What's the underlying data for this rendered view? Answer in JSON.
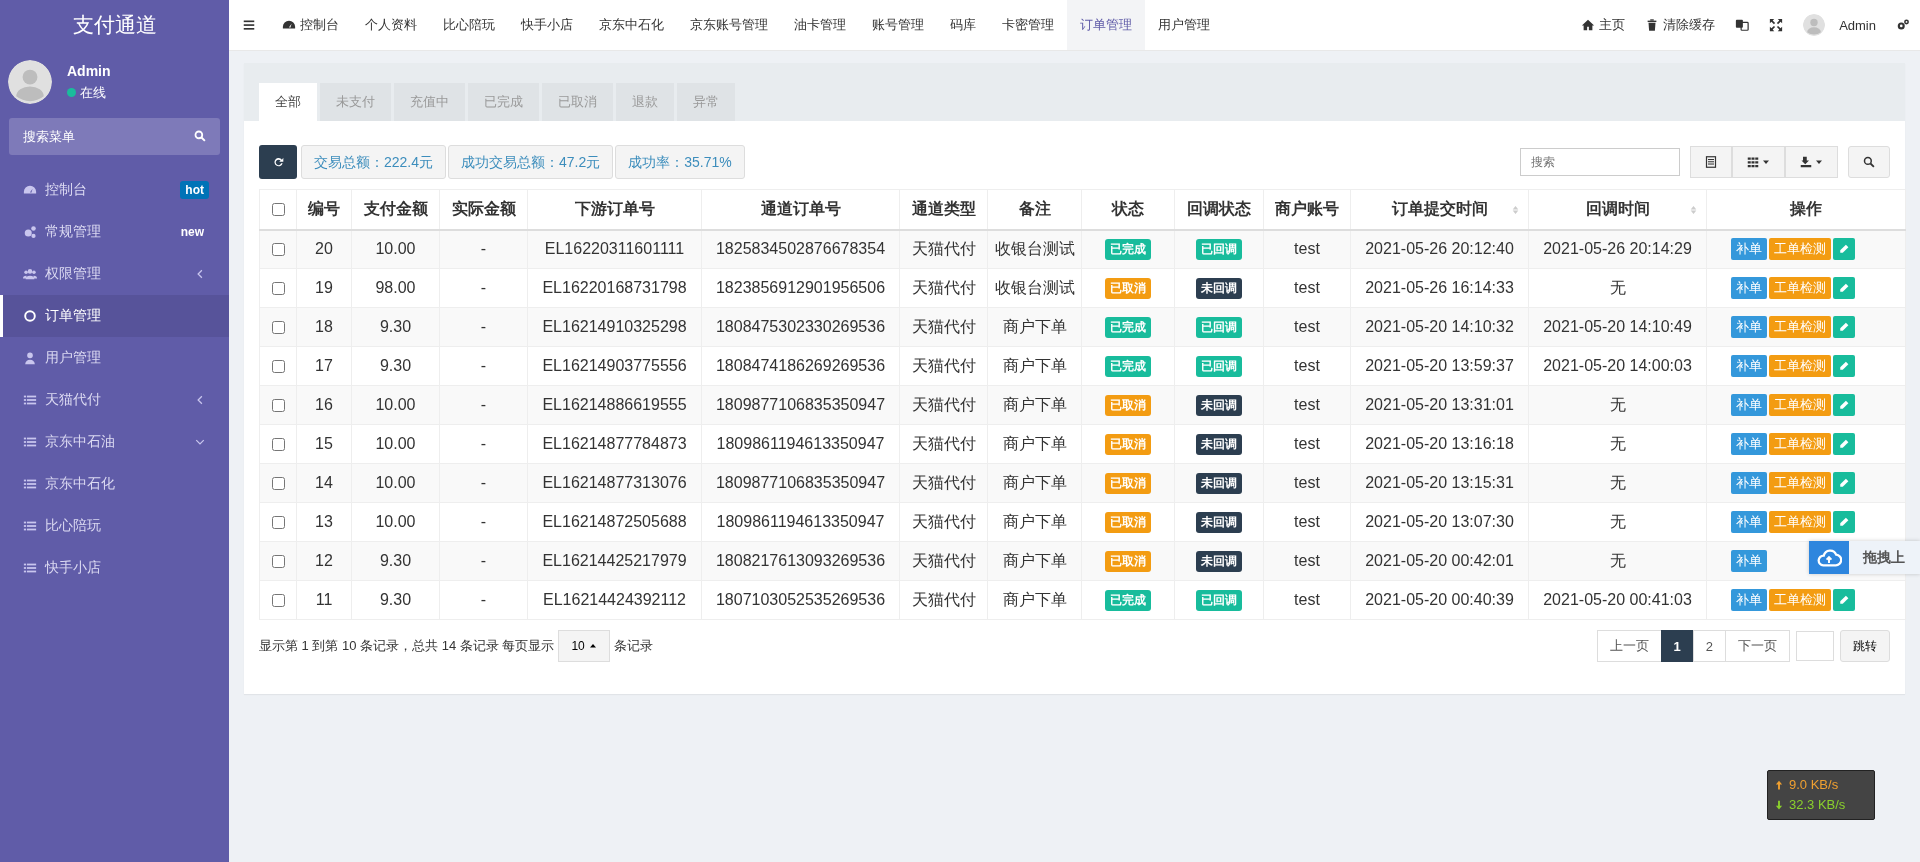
{
  "sidebar": {
    "title": "支付通道",
    "user": {
      "name": "Admin",
      "status": "在线"
    },
    "search": {
      "placeholder": "搜索菜单"
    },
    "items": [
      {
        "label": "控制台",
        "kind": "dashboard",
        "selected": false,
        "badge": {
          "text": "hot",
          "kind": "filled"
        }
      },
      {
        "label": "常规管理",
        "kind": "cogs",
        "selected": false,
        "badge": {
          "text": "new",
          "kind": "plain"
        }
      },
      {
        "label": "权限管理",
        "kind": "users",
        "selected": false,
        "expanded": false
      },
      {
        "label": "订单管理",
        "kind": "circle",
        "selected": true
      },
      {
        "label": "用户管理",
        "kind": "user",
        "selected": false
      },
      {
        "label": "天猫代付",
        "kind": "list",
        "selected": false,
        "expanded": false
      },
      {
        "label": "京东中石油",
        "kind": "list",
        "selected": false,
        "expanded": true
      },
      {
        "label": "京东中石化",
        "kind": "list",
        "selected": false
      },
      {
        "label": "比心陪玩",
        "kind": "list",
        "selected": false
      },
      {
        "label": "快手小店",
        "kind": "list",
        "selected": false
      }
    ]
  },
  "topnav": {
    "items": [
      {
        "label": "控制台",
        "kind": "dashboard",
        "selected": false
      },
      {
        "label": "个人资料",
        "selected": false
      },
      {
        "label": "比心陪玩",
        "selected": false
      },
      {
        "label": "快手小店",
        "selected": false
      },
      {
        "label": "京东中石化",
        "selected": false
      },
      {
        "label": "京东账号管理",
        "selected": false
      },
      {
        "label": "油卡管理",
        "selected": false
      },
      {
        "label": "账号管理",
        "selected": false
      },
      {
        "label": "码库",
        "selected": false
      },
      {
        "label": "卡密管理",
        "selected": false
      },
      {
        "label": "订单管理",
        "selected": true
      },
      {
        "label": "用户管理",
        "selected": false
      }
    ],
    "right": [
      {
        "label": "主页",
        "kind": "home"
      },
      {
        "label": "清除缓存",
        "kind": "trash"
      },
      {
        "kind": "translate"
      },
      {
        "kind": "fullscreen"
      },
      {
        "label": "Admin",
        "kind": "avatar"
      },
      {
        "kind": "settings"
      }
    ]
  },
  "tabs": [
    {
      "label": "全部",
      "selected": true
    },
    {
      "label": "未支付",
      "selected": false
    },
    {
      "label": "充值中",
      "selected": false
    },
    {
      "label": "已完成",
      "selected": false
    },
    {
      "label": "已取消",
      "selected": false
    },
    {
      "label": "退款",
      "selected": false
    },
    {
      "label": "异常",
      "selected": false
    }
  ],
  "stats": [
    "交易总额：222.4元",
    "成功交易总额：47.2元",
    "成功率：35.71%"
  ],
  "search": {
    "placeholder": "搜索"
  },
  "table": {
    "select_all": {
      "checked": false
    },
    "columns": [
      {
        "label": "编号"
      },
      {
        "label": "支付金额"
      },
      {
        "label": "实际金额"
      },
      {
        "label": "下游订单号"
      },
      {
        "label": "通道订单号"
      },
      {
        "label": "通道类型"
      },
      {
        "label": "备注"
      },
      {
        "label": "状态"
      },
      {
        "label": "回调状态"
      },
      {
        "label": "商户账号"
      },
      {
        "label": "订单提交时间",
        "sortable": true
      },
      {
        "label": "回调时间",
        "sortable": true
      },
      {
        "label": "操作"
      }
    ],
    "rows": [
      {
        "checked": false,
        "cells": [
          "20",
          "10.00",
          "-",
          "EL16220311601111",
          "1825834502876678354",
          "天猫代付",
          "收银台测试"
        ],
        "status": {
          "text": "已完成",
          "color": "#18bc9c"
        },
        "callback": {
          "text": "已回调",
          "color": "#18bc9c"
        },
        "account": "test",
        "submitted": "2021-05-26 20:12:40",
        "callback_time": "2021-05-26 20:14:29",
        "actions": [
          "补单",
          "工单检测"
        ],
        "edit": true
      },
      {
        "checked": false,
        "cells": [
          "19",
          "98.00",
          "-",
          "EL16220168731798",
          "1823856912901956506",
          "天猫代付",
          "收银台测试"
        ],
        "status": {
          "text": "已取消",
          "color": "#f39c12"
        },
        "callback": {
          "text": "未回调",
          "color": "#2c3e50"
        },
        "account": "test",
        "submitted": "2021-05-26 16:14:33",
        "callback_time": "无",
        "actions": [
          "补单",
          "工单检测"
        ],
        "edit": true
      },
      {
        "checked": false,
        "cells": [
          "18",
          "9.30",
          "-",
          "EL16214910325298",
          "1808475302330269536",
          "天猫代付",
          "商户下单"
        ],
        "status": {
          "text": "已完成",
          "color": "#18bc9c"
        },
        "callback": {
          "text": "已回调",
          "color": "#18bc9c"
        },
        "account": "test",
        "submitted": "2021-05-20 14:10:32",
        "callback_time": "2021-05-20 14:10:49",
        "actions": [
          "补单",
          "工单检测"
        ],
        "edit": true
      },
      {
        "checked": false,
        "cells": [
          "17",
          "9.30",
          "-",
          "EL16214903775556",
          "1808474186269269536",
          "天猫代付",
          "商户下单"
        ],
        "status": {
          "text": "已完成",
          "color": "#18bc9c"
        },
        "callback": {
          "text": "已回调",
          "color": "#18bc9c"
        },
        "account": "test",
        "submitted": "2021-05-20 13:59:37",
        "callback_time": "2021-05-20 14:00:03",
        "actions": [
          "补单",
          "工单检测"
        ],
        "edit": true
      },
      {
        "checked": false,
        "cells": [
          "16",
          "10.00",
          "-",
          "EL16214886619555",
          "1809877106835350947",
          "天猫代付",
          "商户下单"
        ],
        "status": {
          "text": "已取消",
          "color": "#f39c12"
        },
        "callback": {
          "text": "未回调",
          "color": "#2c3e50"
        },
        "account": "test",
        "submitted": "2021-05-20 13:31:01",
        "callback_time": "无",
        "actions": [
          "补单",
          "工单检测"
        ],
        "edit": true
      },
      {
        "checked": false,
        "cells": [
          "15",
          "10.00",
          "-",
          "EL16214877784873",
          "1809861194613350947",
          "天猫代付",
          "商户下单"
        ],
        "status": {
          "text": "已取消",
          "color": "#f39c12"
        },
        "callback": {
          "text": "未回调",
          "color": "#2c3e50"
        },
        "account": "test",
        "submitted": "2021-05-20 13:16:18",
        "callback_time": "无",
        "actions": [
          "补单",
          "工单检测"
        ],
        "edit": true
      },
      {
        "checked": false,
        "cells": [
          "14",
          "10.00",
          "-",
          "EL16214877313076",
          "1809877106835350947",
          "天猫代付",
          "商户下单"
        ],
        "status": {
          "text": "已取消",
          "color": "#f39c12"
        },
        "callback": {
          "text": "未回调",
          "color": "#2c3e50"
        },
        "account": "test",
        "submitted": "2021-05-20 13:15:31",
        "callback_time": "无",
        "actions": [
          "补单",
          "工单检测"
        ],
        "edit": true
      },
      {
        "checked": false,
        "cells": [
          "13",
          "10.00",
          "-",
          "EL16214872505688",
          "1809861194613350947",
          "天猫代付",
          "商户下单"
        ],
        "status": {
          "text": "已取消",
          "color": "#f39c12"
        },
        "callback": {
          "text": "未回调",
          "color": "#2c3e50"
        },
        "account": "test",
        "submitted": "2021-05-20 13:07:30",
        "callback_time": "无",
        "actions": [
          "补单",
          "工单检测"
        ],
        "edit": true
      },
      {
        "checked": false,
        "cells": [
          "12",
          "9.30",
          "-",
          "EL16214425217979",
          "1808217613093269536",
          "天猫代付",
          "商户下单"
        ],
        "status": {
          "text": "已取消",
          "color": "#f39c12"
        },
        "callback": {
          "text": "未回调",
          "color": "#2c3e50"
        },
        "account": "test",
        "submitted": "2021-05-20 00:42:01",
        "callback_time": "无",
        "actions": [
          "补单"
        ],
        "edit": false
      },
      {
        "checked": false,
        "cells": [
          "11",
          "9.30",
          "-",
          "EL16214424392112",
          "1807103052535269536",
          "天猫代付",
          "商户下单"
        ],
        "status": {
          "text": "已完成",
          "color": "#18bc9c"
        },
        "callback": {
          "text": "已回调",
          "color": "#18bc9c"
        },
        "account": "test",
        "submitted": "2021-05-20 00:40:39",
        "callback_time": "2021-05-20 00:41:03",
        "actions": [
          "补单",
          "工单检测"
        ],
        "edit": true
      }
    ]
  },
  "pagination": {
    "info": "显示第 1 到第 10 条记录，总共 14 条记录 每页显示",
    "page_size": "10",
    "suffix": "条记录",
    "prev": "上一页",
    "pages": [
      {
        "label": "1",
        "selected": true
      },
      {
        "label": "2",
        "selected": false
      }
    ],
    "next": "下一页",
    "jump": "跳转"
  },
  "upload_widget": {
    "label": "拖拽上"
  },
  "net_speed": {
    "up": "9.0 KB/s",
    "down": "32.3 KB/s"
  }
}
